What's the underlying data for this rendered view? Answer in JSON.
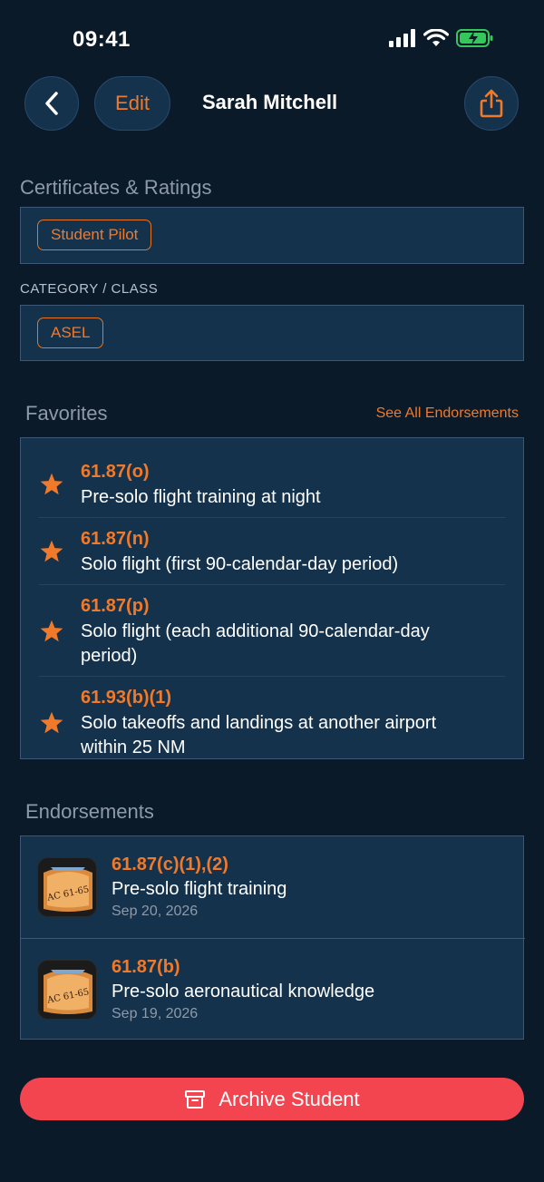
{
  "status_bar": {
    "time": "09:41"
  },
  "nav": {
    "edit_label": "Edit",
    "title": "Sarah Mitchell"
  },
  "certificates": {
    "title": "Certificates & Ratings",
    "chips": [
      "Student Pilot"
    ]
  },
  "category_class": {
    "title": "CATEGORY / CLASS",
    "chips": [
      "ASEL"
    ]
  },
  "favorites": {
    "title": "Favorites",
    "see_all_label": "See All Endorsements",
    "items": [
      {
        "code": "61.87(o)",
        "desc": "Pre-solo flight training at night"
      },
      {
        "code": "61.87(n)",
        "desc": "Solo flight (first 90-calendar-day period)"
      },
      {
        "code": "61.87(p)",
        "desc": "Solo flight (each additional 90-calendar-day period)"
      },
      {
        "code": "61.93(b)(1)",
        "desc": "Solo takeoffs and landings at another airport within 25 NM"
      }
    ]
  },
  "endorsements": {
    "title": "Endorsements",
    "items": [
      {
        "code": "61.87(c)(1),(2)",
        "desc": "Pre-solo flight training",
        "date": "Sep 20, 2026",
        "icon_text": "AC 61-65"
      },
      {
        "code": "61.87(b)",
        "desc": "Pre-solo aeronautical knowledge",
        "date": "Sep 19, 2026",
        "icon_text": "AC 61-65"
      }
    ]
  },
  "archive": {
    "label": "Archive Student"
  },
  "colors": {
    "accent": "#f07a2a",
    "background": "#0b1a29",
    "card": "#15324d",
    "danger": "#f2454f"
  }
}
